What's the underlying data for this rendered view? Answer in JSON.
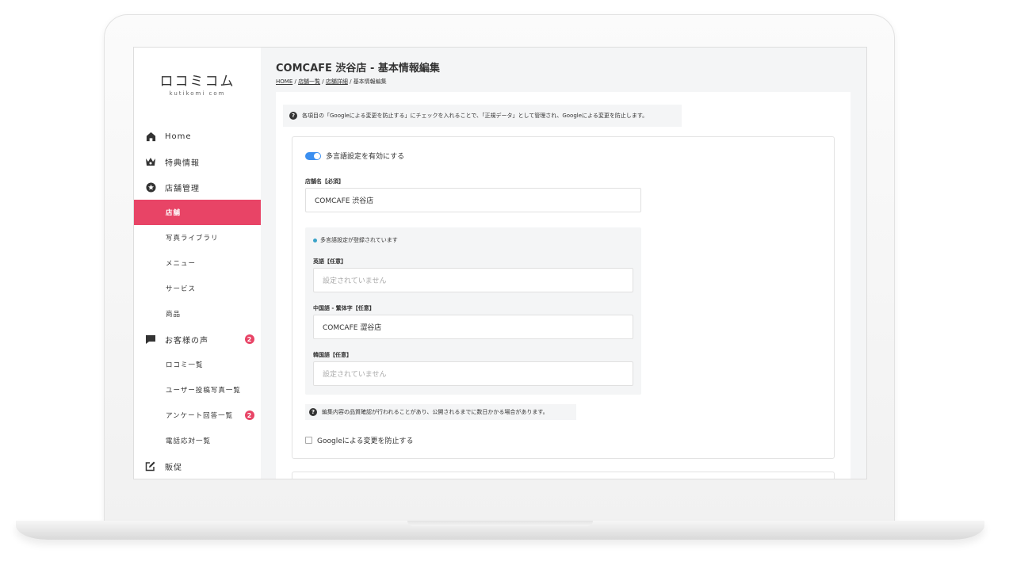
{
  "sidebar": {
    "logo_mark": "ロコミコム",
    "logo_sub": "kutikomi com",
    "items": [
      {
        "label": "Home",
        "icon": "home-icon"
      },
      {
        "label": "特典情報",
        "icon": "crown-icon"
      },
      {
        "label": "店舗管理",
        "icon": "star-badge-icon"
      },
      {
        "label": "店舗"
      },
      {
        "label": "写真ライブラリ"
      },
      {
        "label": "メニュー"
      },
      {
        "label": "サービス"
      },
      {
        "label": "商品"
      },
      {
        "label": "お客様の声",
        "icon": "chat-icon",
        "badge": "2"
      },
      {
        "label": "ロコミ一覧"
      },
      {
        "label": "ユーザー投稿写真一覧"
      },
      {
        "label": "アンケート回答一覧",
        "badge": "2"
      },
      {
        "label": "電話応対一覧"
      },
      {
        "label": "販促",
        "icon": "edit-icon"
      }
    ],
    "active_color": "#e84466"
  },
  "header": {
    "title": "COMCAFE 渋谷店 - 基本情報編集",
    "breadcrumb": [
      "HOME",
      "店舗一覧",
      "店舗詳細",
      "基本情報編集"
    ],
    "separator": " / "
  },
  "info_note": {
    "icon": "question-icon",
    "text": "各項目の「Googleによる変更を防止する」にチェックを入れることで、「正規データ」として管理され、Googleによる変更を防止します。"
  },
  "form": {
    "multilang_toggle_label": "多言語設定を有効にする",
    "multilang_enabled": true,
    "store_name_label": "店舗名【必須】",
    "store_name_value": "COMCAFE 渋谷店",
    "multilang_status": "多言語設定が登録されています",
    "english_label": "英語【任意】",
    "english_placeholder": "設定されていません",
    "chinese_label": "中国語 - 繁体字【任意】",
    "chinese_value": "COMCAFE 澀谷店",
    "korean_label": "韓国語【任意】",
    "korean_placeholder": "設定されていません",
    "warn_text": "編集内容の品質確認が行われることがあり、公開されるまでに数日かかる場合があります。",
    "prevent_google_label": "Googleによる変更を防止する",
    "prevent_google_checked": false
  },
  "colors": {
    "toggle": "#3b8ff0",
    "status_dot": "#3aa3c8",
    "badge": "#e84466"
  }
}
